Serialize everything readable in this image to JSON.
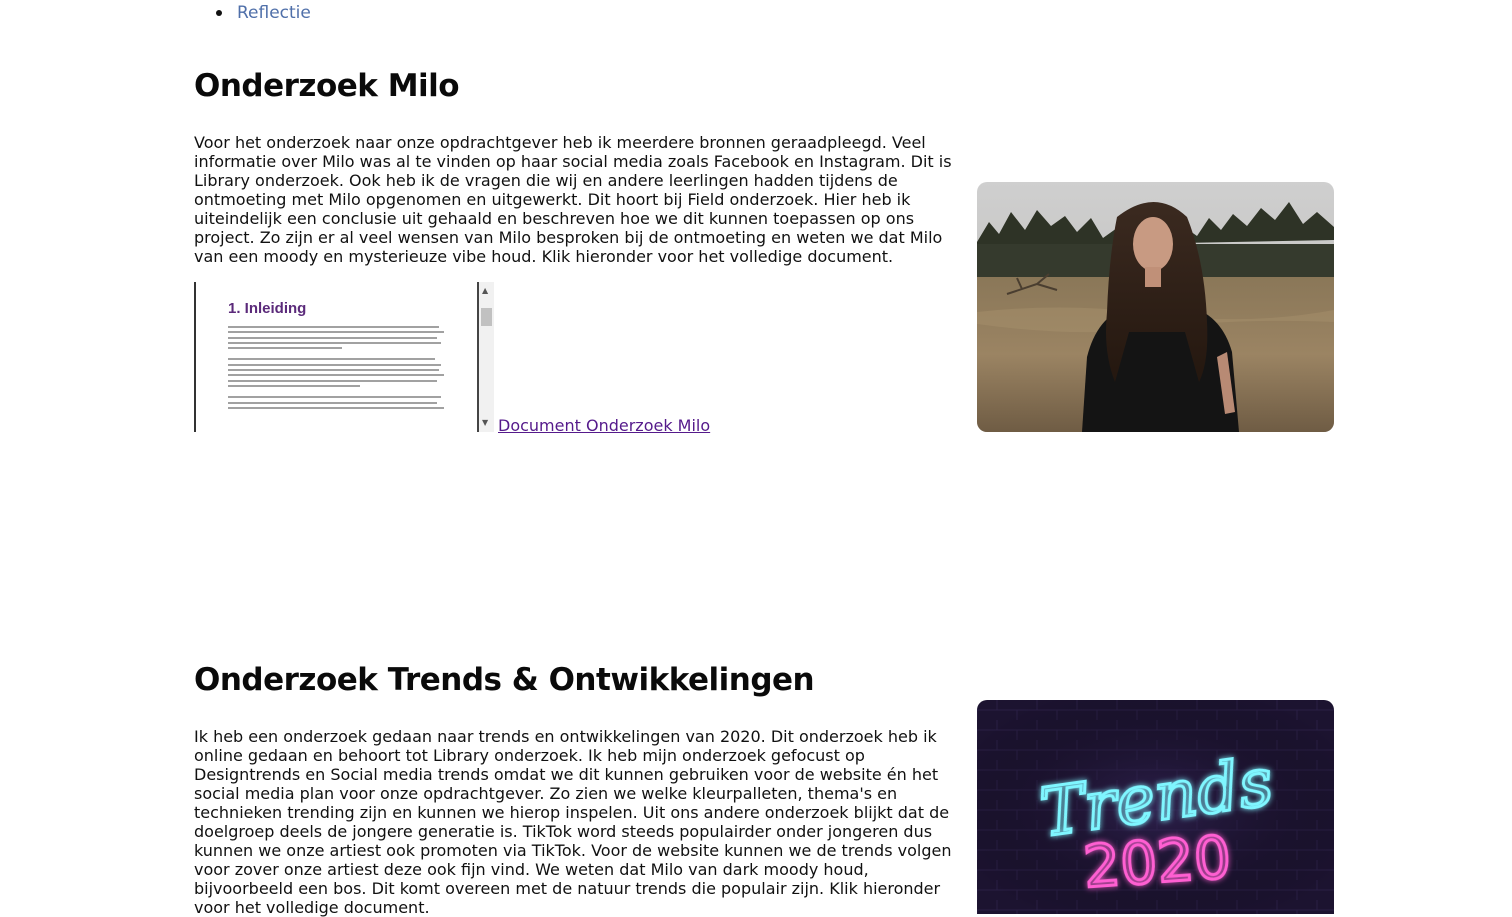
{
  "nav": {
    "items": [
      {
        "label": "Reflectie"
      }
    ]
  },
  "milo": {
    "title": "Onderzoek Milo",
    "text": "Voor het onderzoek naar onze opdrachtgever heb ik meerdere bronnen geraadpleegd. Veel informatie over Milo was al te vinden op haar social media zoals Facebook en Instagram. Dit is Library onderzoek. Ook heb ik de vragen die wij en andere leerlingen hadden tijdens de ontmoeting met Milo opgenomen en uitgewerkt. Dit hoort bij Field onderzoek. Hier heb ik uiteindelijk een conclusie uit gehaald en beschreven hoe we dit kunnen toepassen op ons project. Zo zijn er al veel wensen van Milo besproken bij de ontmoeting en weten we dat Milo van een moody en mysterieuze vibe houd. Klik hieronder voor het volledige document.",
    "doc_preview_heading": "1. Inleiding",
    "doc_link": "Document Onderzoek Milo"
  },
  "trends": {
    "title": "Onderzoek Trends & Ontwikkelingen",
    "text": "Ik heb een onderzoek gedaan naar trends en ontwikkelingen van 2020. Dit onderzoek heb ik online gedaan en behoort tot Library onderzoek. Ik heb mijn onderzoek gefocust op Designtrends en Social media trends omdat we dit kunnen gebruiken voor de website én het social media plan voor onze opdrachtgever. Zo zien we welke kleurpalleten, thema's en technieken trending zijn en kunnen we hierop inspelen. Uit ons andere onderzoek blijkt dat de doelgroep deels de jongere generatie is. TikTok word steeds populairder onder jongeren dus kunnen we onze artiest ook promoten via TikTok. Voor de website kunnen we de trends volgen voor zover onze artiest deze ook fijn vind. We weten dat Milo van dark moody houd, bijvoorbeeld een bos. Dit komt overeen met de natuur trends die populair zijn. Klik hieronder voor het volledige document.",
    "neon_word": "Trends",
    "neon_year": "2020"
  },
  "colors": {
    "link": "#4f6fa9",
    "visited_link": "#551a8b",
    "neon_cyan": "#7ff6ff",
    "neon_pink": "#ff5fd2",
    "doc_heading": "#5b2a7a"
  }
}
